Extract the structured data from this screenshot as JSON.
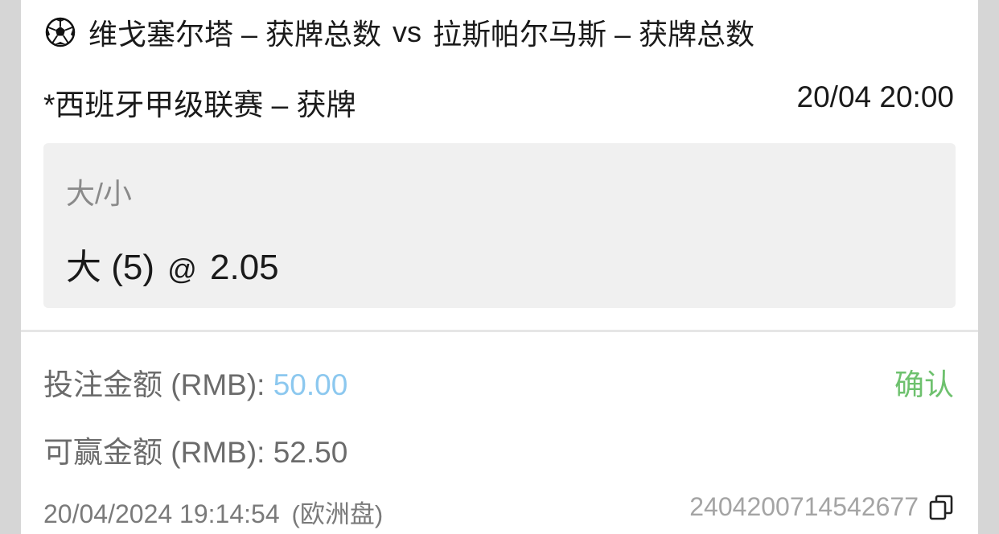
{
  "match": {
    "home": "维戈塞尔塔 – 获牌总数",
    "vs": "vs",
    "away": "拉斯帕尔马斯 – 获牌总数",
    "icon": "soccer-ball-icon"
  },
  "league": "*西班牙甲级联赛 – 获牌",
  "kickoff": "20/04 20:00",
  "selection": {
    "market": "大/小",
    "pick": "大 (5)",
    "at": "@",
    "odds": "2.05"
  },
  "stake": {
    "label": "投注金额 (RMB):",
    "value": "50.00",
    "value_color": "#8cc8ef"
  },
  "confirm_label": "确认",
  "confirm_color": "#6ec16e",
  "win": {
    "label": "可赢金额 (RMB):",
    "value": "52.50"
  },
  "placed_time": "20/04/2024 19:14:54",
  "odds_type": "(欧洲盘)",
  "bet_id": "2404200714542677",
  "copy_icon": "copy-icon"
}
